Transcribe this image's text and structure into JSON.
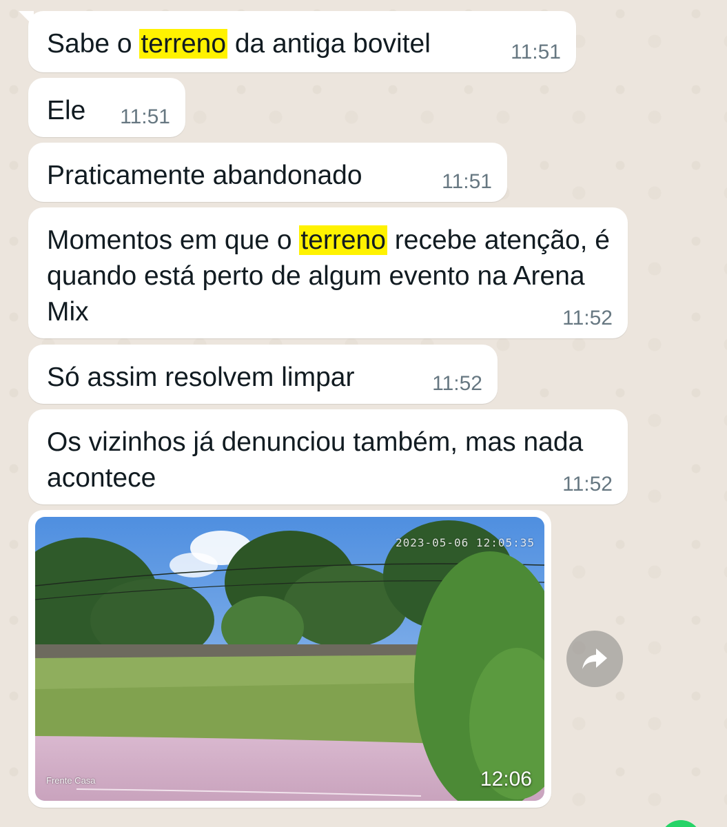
{
  "messages": [
    {
      "parts": [
        "Sabe o ",
        "terreno",
        " da antiga bovitel"
      ],
      "time": "11:51"
    },
    {
      "parts": [
        "Ele"
      ],
      "time": "11:51"
    },
    {
      "parts": [
        "Praticamente abandonado"
      ],
      "time": "11:51"
    },
    {
      "parts": [
        "Momentos em que o ",
        "terreno",
        " recebe atenção, é quando está perto de algum evento na Arena Mix"
      ],
      "time": "11:52"
    },
    {
      "parts": [
        "Só assim resolvem limpar"
      ],
      "time": "11:52"
    },
    {
      "parts": [
        "Os vizinhos já denunciou também, mas nada acontece"
      ],
      "time": "11:52"
    }
  ],
  "image_message": {
    "camera_timestamp": "2023-05-06 12:05:35",
    "camera_label": "Frente Casa",
    "time": "12:06"
  },
  "icons": {
    "forward": "forward-arrow-icon"
  },
  "colors": {
    "chat_background": "#ece5dd",
    "bubble": "#ffffff",
    "highlight": "#fff200",
    "timestamp": "#667781"
  }
}
